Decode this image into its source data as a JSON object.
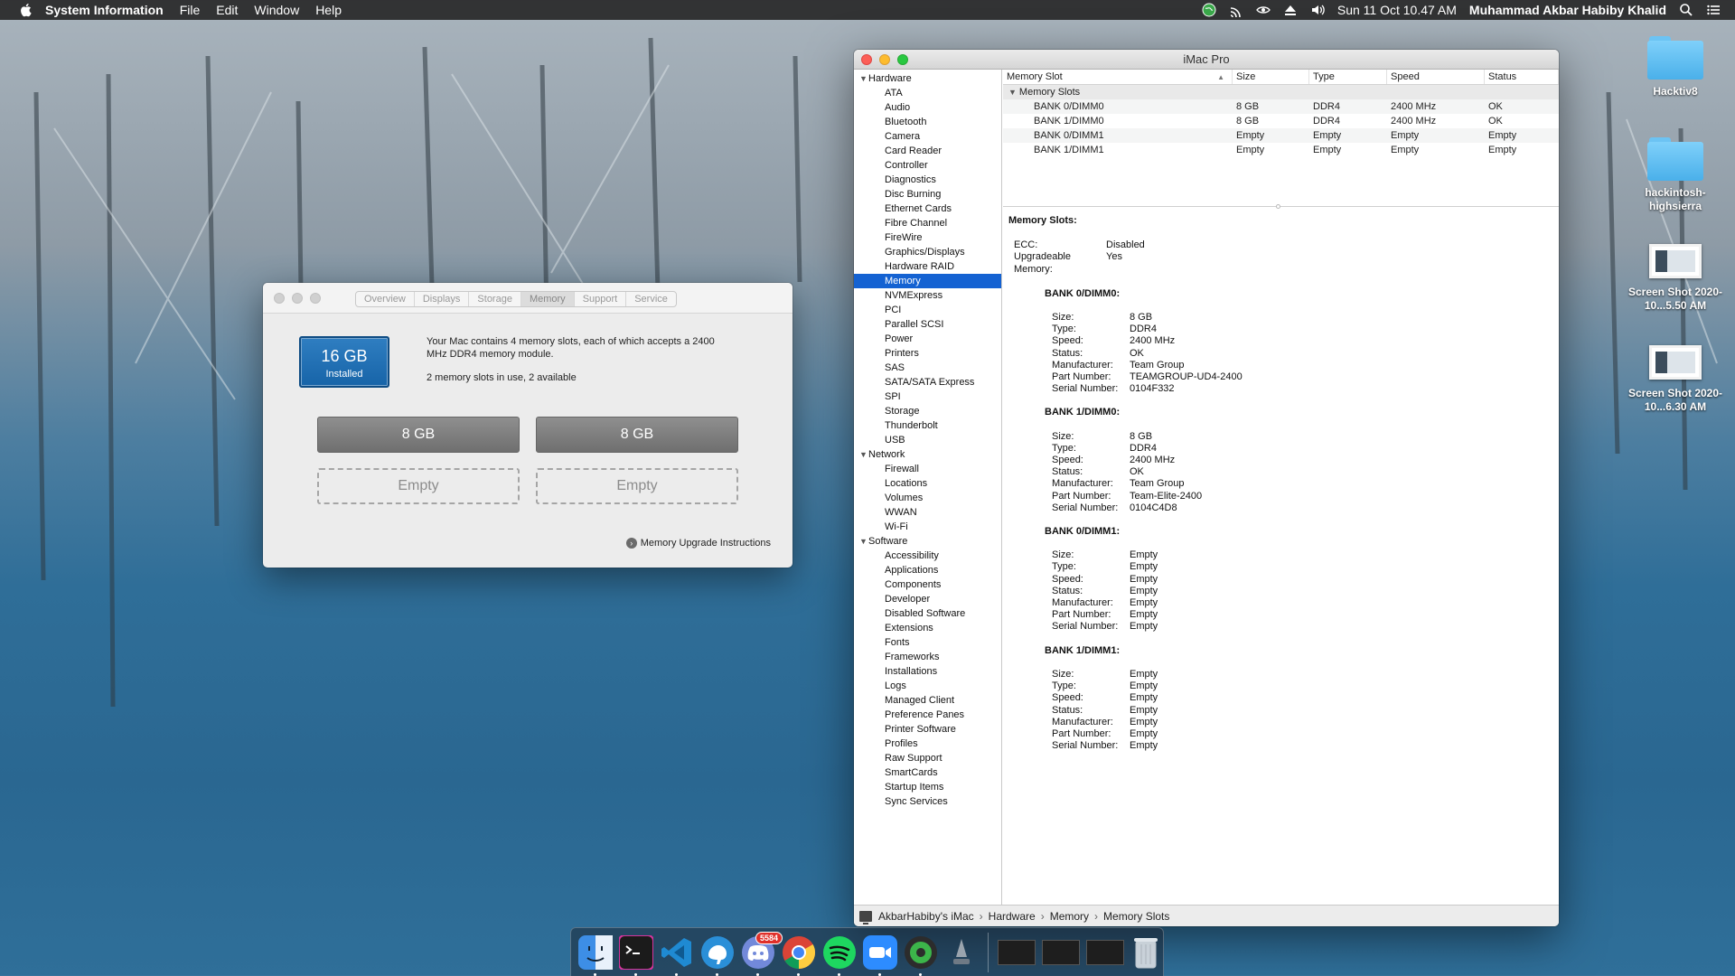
{
  "menubar": {
    "app_name": "System Information",
    "menus": [
      "File",
      "Edit",
      "Window",
      "Help"
    ],
    "clock": "Sun 11 Oct  10.47 AM",
    "user": "Muhammad Akbar Habiby Khalid"
  },
  "desktop": {
    "icons": [
      {
        "label": "Hacktiv8",
        "kind": "folder"
      },
      {
        "label": "hackintosh-highsierra",
        "kind": "folder"
      },
      {
        "label": "Screen Shot 2020-10...5.50 AM",
        "kind": "screenshot"
      },
      {
        "label": "Screen Shot 2020-10...6.30 AM",
        "kind": "screenshot"
      }
    ]
  },
  "about": {
    "tabs": [
      "Overview",
      "Displays",
      "Storage",
      "Memory",
      "Support",
      "Service"
    ],
    "active_tab": "Memory",
    "installed_size": "16 GB",
    "installed_label": "Installed",
    "description": "Your Mac contains 4 memory slots, each of which accepts a 2400 MHz DDR4 memory module.",
    "slots_summary": "2 memory slots in use, 2 available",
    "slots": [
      "8 GB",
      "8 GB",
      "Empty",
      "Empty"
    ],
    "upgrade_link": "Memory Upgrade Instructions"
  },
  "sysinfo": {
    "title": "iMac Pro",
    "sidebar": {
      "hardware_label": "Hardware",
      "hardware": [
        "ATA",
        "Audio",
        "Bluetooth",
        "Camera",
        "Card Reader",
        "Controller",
        "Diagnostics",
        "Disc Burning",
        "Ethernet Cards",
        "Fibre Channel",
        "FireWire",
        "Graphics/Displays",
        "Hardware RAID",
        "Memory",
        "NVMExpress",
        "PCI",
        "Parallel SCSI",
        "Power",
        "Printers",
        "SAS",
        "SATA/SATA Express",
        "SPI",
        "Storage",
        "Thunderbolt",
        "USB"
      ],
      "network_label": "Network",
      "network": [
        "Firewall",
        "Locations",
        "Volumes",
        "WWAN",
        "Wi-Fi"
      ],
      "software_label": "Software",
      "software": [
        "Accessibility",
        "Applications",
        "Components",
        "Developer",
        "Disabled Software",
        "Extensions",
        "Fonts",
        "Frameworks",
        "Installations",
        "Logs",
        "Managed Client",
        "Preference Panes",
        "Printer Software",
        "Profiles",
        "Raw Support",
        "SmartCards",
        "Startup Items",
        "Sync Services"
      ],
      "selected": "Memory"
    },
    "table": {
      "headers": [
        "Memory Slot",
        "Size",
        "Type",
        "Speed",
        "Status"
      ],
      "group": "Memory Slots",
      "rows": [
        [
          "BANK 0/DIMM0",
          "8 GB",
          "DDR4",
          "2400 MHz",
          "OK"
        ],
        [
          "BANK 1/DIMM0",
          "8 GB",
          "DDR4",
          "2400 MHz",
          "OK"
        ],
        [
          "BANK 0/DIMM1",
          "Empty",
          "Empty",
          "Empty",
          "Empty"
        ],
        [
          "BANK 1/DIMM1",
          "Empty",
          "Empty",
          "Empty",
          "Empty"
        ]
      ]
    },
    "detail": {
      "title": "Memory Slots:",
      "ecc_label": "ECC:",
      "ecc": "Disabled",
      "upgradeable_label": "Upgradeable Memory:",
      "upgradeable": "Yes",
      "field_labels": [
        "Size:",
        "Type:",
        "Speed:",
        "Status:",
        "Manufacturer:",
        "Part Number:",
        "Serial Number:"
      ],
      "banks": [
        {
          "name": "BANK 0/DIMM0:",
          "values": [
            "8 GB",
            "DDR4",
            "2400 MHz",
            "OK",
            "Team Group",
            "TEAMGROUP-UD4-2400",
            "0104F332"
          ]
        },
        {
          "name": "BANK 1/DIMM0:",
          "values": [
            "8 GB",
            "DDR4",
            "2400 MHz",
            "OK",
            "Team Group",
            "Team-Elite-2400",
            "0104C4D8"
          ]
        },
        {
          "name": "BANK 0/DIMM1:",
          "values": [
            "Empty",
            "Empty",
            "Empty",
            "Empty",
            "Empty",
            "Empty",
            "Empty"
          ]
        },
        {
          "name": "BANK 1/DIMM1:",
          "values": [
            "Empty",
            "Empty",
            "Empty",
            "Empty",
            "Empty",
            "Empty",
            "Empty"
          ]
        }
      ]
    },
    "pathbar": [
      "AkbarHabiby's iMac",
      "Hardware",
      "Memory",
      "Memory Slots"
    ]
  },
  "dock": {
    "apps": [
      "finder-icon",
      "terminal-icon",
      "vscode-icon",
      "tableplus-icon",
      "discord-icon",
      "chrome-icon",
      "spotify-icon",
      "zoom-icon",
      "sourcetree-icon",
      "launchpad-icon"
    ],
    "discord_badge": "5584"
  }
}
